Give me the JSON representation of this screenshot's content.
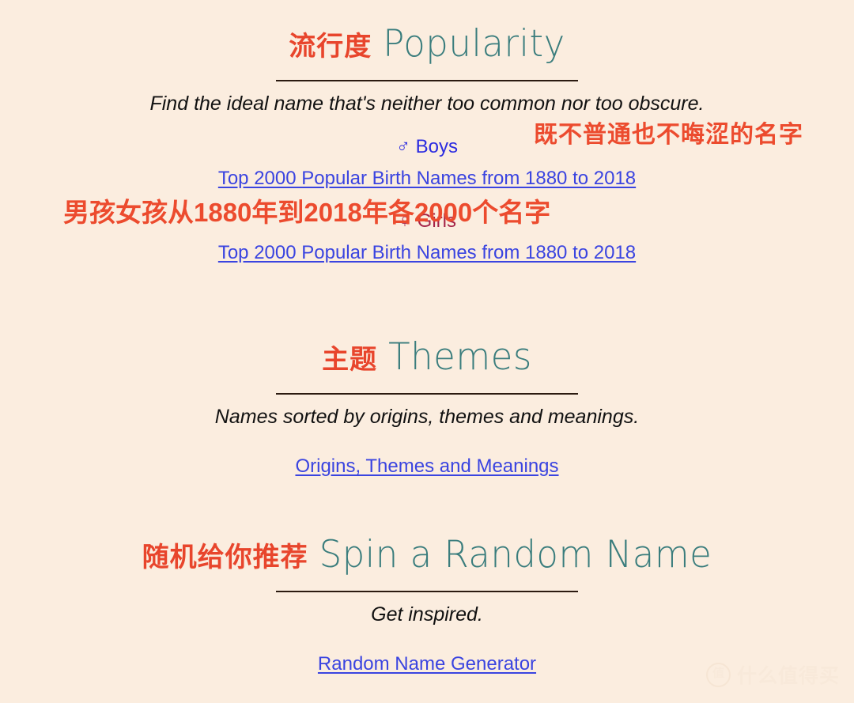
{
  "page": {
    "background_color": "#FBEDDF",
    "accent_teal": "#3A7D7D",
    "accent_red": "#E8452C",
    "link_blue": "#3A44E0",
    "boys_blue": "#2B2BE0",
    "girls_maroon": "#A52448"
  },
  "sections": [
    {
      "id": "popularity",
      "heading_cn": "流行度",
      "heading_en": "Popularity",
      "tagline": "Find the ideal name that's neither too common nor too obscure.",
      "boys_label": "♂ Boys",
      "boys_link": "Top 2000 Popular Birth Names from 1880 to 2018",
      "girls_label": "♀ Girls",
      "girls_link": "Top 2000 Popular Birth Names from 1880 to 2018"
    },
    {
      "id": "themes",
      "heading_cn": "主题",
      "heading_en": "Themes",
      "tagline": "Names sorted by origins, themes and meanings.",
      "link": "Origins, Themes and Meanings"
    },
    {
      "id": "random",
      "heading_cn": "随机给你推荐",
      "heading_en": "Spin a Random Name",
      "tagline": "Get inspired.",
      "link": "Random Name Generator"
    }
  ],
  "annotations": [
    {
      "id": "annot-1",
      "text": "既不普通也不晦涩的名字"
    },
    {
      "id": "annot-2",
      "text": "男孩女孩从1880年到2018年各2000个名字"
    }
  ],
  "watermark": {
    "logo_glyph": "值",
    "text": "什么值得买"
  }
}
